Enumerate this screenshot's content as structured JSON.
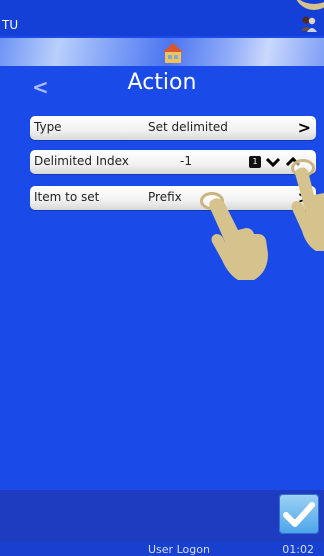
{
  "status": {
    "left_text": "TU"
  },
  "header": {
    "title": "Action"
  },
  "rows": [
    {
      "label": "Type",
      "value": "Set delimited"
    },
    {
      "label": "Delimited Index",
      "value": "-1",
      "badge": "1"
    },
    {
      "label": "Item to set",
      "value": "Prefix"
    }
  ],
  "footer": {
    "user_logon": "User Logon",
    "time": "01:02"
  },
  "icons": {
    "status": "users-icon",
    "banner": "home-icon",
    "back": "back-arrow-icon",
    "row": "chevron-right-icon",
    "stepper_down": "chevron-down-icon",
    "stepper_up": "chevron-up-icon",
    "confirm": "checkmark-icon",
    "touch": "hand-pointer-icon"
  },
  "colors": {
    "background": "#1a4be8",
    "text": "#ffffff",
    "confirm": "#4aa4ea",
    "hand": "#d6c28c"
  }
}
